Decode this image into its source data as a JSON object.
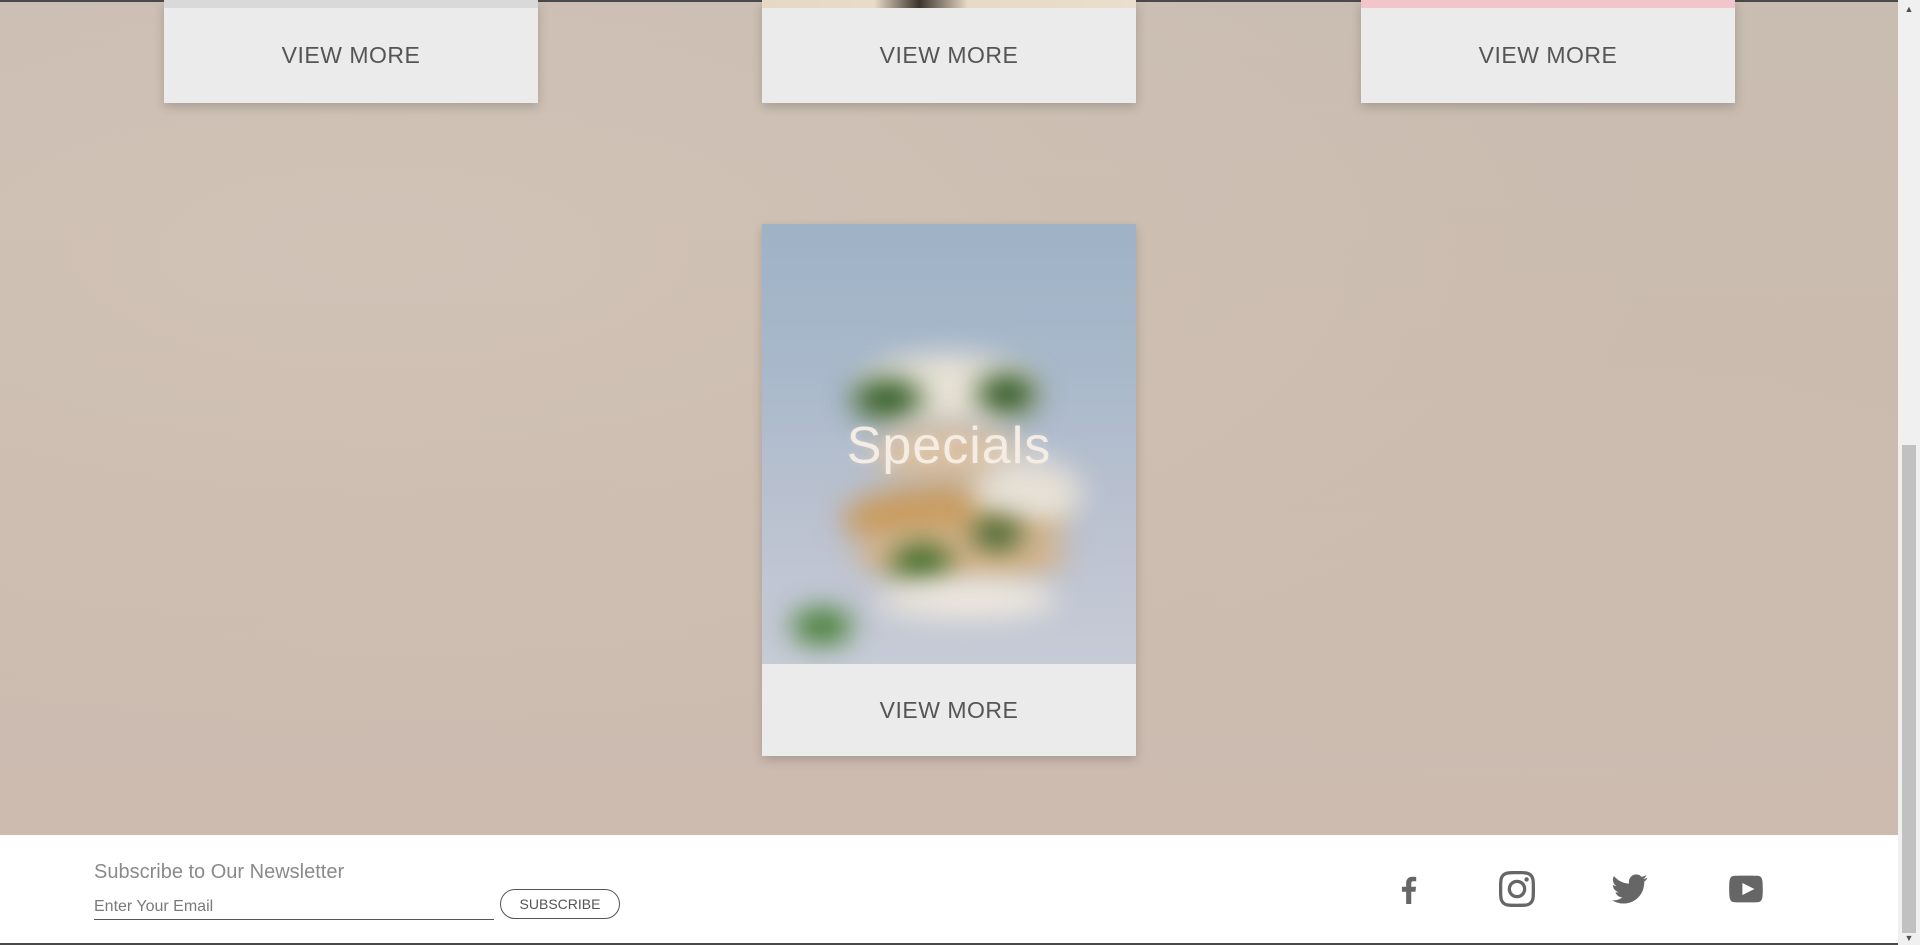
{
  "cards": [
    {
      "button_label": "VIEW MORE"
    },
    {
      "button_label": "VIEW MORE"
    },
    {
      "button_label": "VIEW MORE"
    }
  ],
  "specials": {
    "title": "Specials",
    "button_label": "VIEW MORE"
  },
  "newsletter": {
    "title": "Subscribe to Our Newsletter",
    "placeholder": "Enter Your Email",
    "button_label": "SUBSCRIBE"
  },
  "social": [
    {
      "icon": "facebook-icon"
    },
    {
      "icon": "instagram-icon"
    },
    {
      "icon": "twitter-icon"
    },
    {
      "icon": "youtube-icon"
    }
  ],
  "colors": {
    "page_background": "#cbbdb1",
    "card_background": "#ebebeb",
    "text_gray": "#555555",
    "footer_background": "#ffffff"
  }
}
